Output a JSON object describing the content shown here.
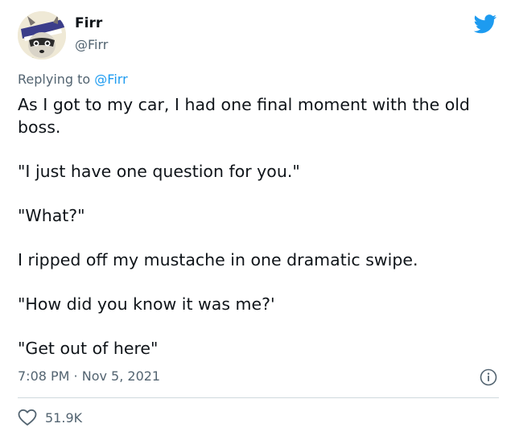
{
  "author": {
    "display_name": "Firr",
    "handle": "@Firr",
    "avatar_icon": "raccoon-avatar-icon"
  },
  "header": {
    "logo_icon": "twitter-bird-icon",
    "logo_color": "#1d9bf0"
  },
  "reply": {
    "prefix": "Replying to",
    "mention": "@Firr"
  },
  "tweet": {
    "paragraphs": [
      "As I got to my car, I had one final moment with the old boss.",
      "\"I just have one question for you.\"",
      "\"What?\"",
      "I ripped off my mustache in one dramatic swipe.",
      "\"How did you know it was me?'",
      "\"Get out of here\""
    ],
    "timestamp": "7:08 PM · Nov 5, 2021",
    "info_icon": "info-icon"
  },
  "stats": {
    "like_icon": "heart-icon",
    "likes": "51.9K"
  },
  "colors": {
    "text": "#0f1419",
    "secondary": "#536471",
    "accent": "#1d9bf0",
    "divider": "#cfd9de"
  }
}
